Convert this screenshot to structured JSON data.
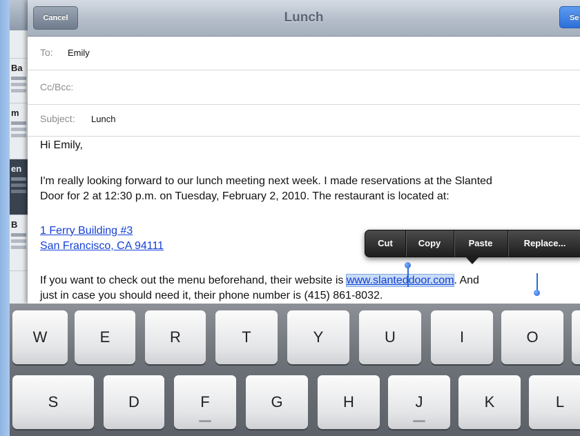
{
  "background_list": {
    "rows": [
      "Ba",
      "m",
      "en",
      "B"
    ]
  },
  "compose": {
    "title": "Lunch",
    "cancel_label": "Cancel",
    "send_label": "Se",
    "to_label": "To:",
    "to_value": "Emily",
    "cc_label": "Cc/Bcc:",
    "subject_label": "Subject:",
    "subject_value": "Lunch",
    "greeting": "Hi Emily,",
    "para1_line1": "I'm really looking forward to our lunch meeting next week. I made reservations at the Slanted",
    "para1_line2": "Door for 2 at 12:30 p.m. on Tuesday, February 2, 2010. The restaurant is located at:",
    "address_line1": "1 Ferry Building #3",
    "address_line2": "San Francisco, CA 94111",
    "para2_line1_before": "If you want to check out the menu beforehand, their website is ",
    "website": "www.slanteddoor.com",
    "para2_line1_after": ". And",
    "para2_line2": "just in case you should need it, their phone number is (415) 861-8032."
  },
  "edit_menu": {
    "cut": "Cut",
    "copy": "Copy",
    "paste": "Paste",
    "replace": "Replace..."
  },
  "keyboard": {
    "row1": [
      "W",
      "E",
      "R",
      "T",
      "Y",
      "U",
      "I",
      "O"
    ],
    "row2": [
      "S",
      "D",
      "F",
      "G",
      "H",
      "J",
      "K",
      "L"
    ]
  },
  "colors": {
    "link": "#1540d6",
    "selection": "#c9dcf5",
    "send_button": "#2d6fd8"
  }
}
